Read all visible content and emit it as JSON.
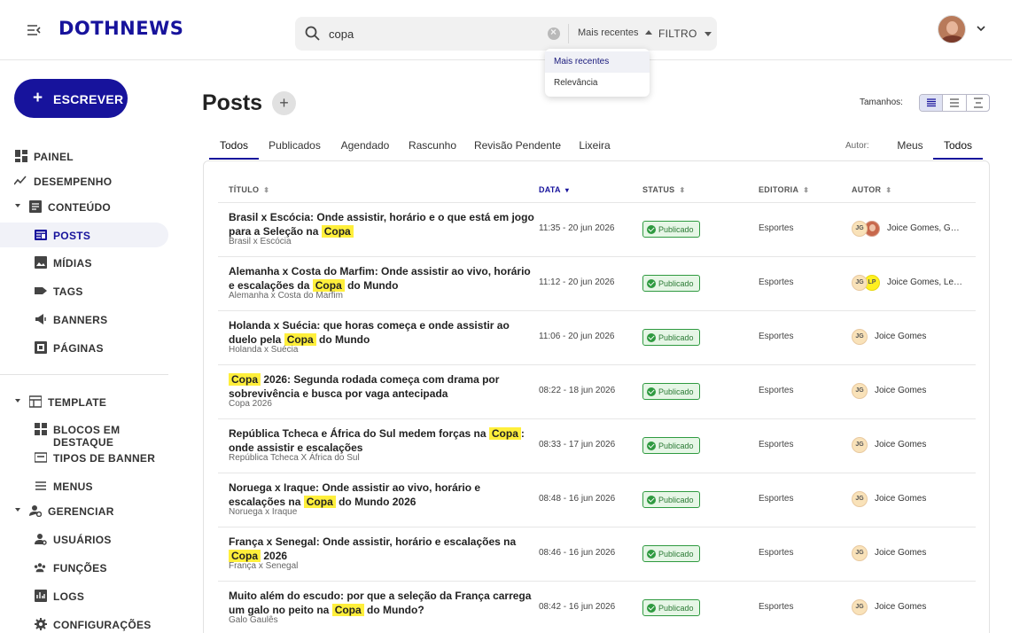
{
  "header": {
    "logo": "DOTHNEWS",
    "search": {
      "value": "copa"
    },
    "sort_label": "Mais recentes",
    "filter_label": "FILTRO",
    "sort_options": [
      "Mais recentes",
      "Relevância"
    ]
  },
  "sidebar": {
    "write_label": "ESCREVER",
    "items": [
      {
        "label": "PAINEL",
        "icon": "dashboard-icon"
      },
      {
        "label": "DESEMPENHO",
        "icon": "trending-icon"
      },
      {
        "label": "CONTEÚDO",
        "icon": "article-icon",
        "expanded": true
      },
      {
        "label": "POSTS",
        "icon": "posts-icon",
        "active": true
      },
      {
        "label": "MÍDIAS",
        "icon": "image-icon"
      },
      {
        "label": "TAGS",
        "icon": "tag-icon"
      },
      {
        "label": "BANNERS",
        "icon": "megaphone-icon"
      },
      {
        "label": "PÁGINAS",
        "icon": "pages-icon"
      },
      {
        "label": "TEMPLATE",
        "icon": "template-icon",
        "expanded": true
      },
      {
        "label": "BLOCOS EM DESTAQUE",
        "icon": "blocks-icon"
      },
      {
        "label": "TIPOS DE BANNER",
        "icon": "banner-type-icon"
      },
      {
        "label": "MENUS",
        "icon": "menu-lines-icon"
      },
      {
        "label": "GERENCIAR",
        "icon": "manage-icon",
        "expanded": true
      },
      {
        "label": "USUÁRIOS",
        "icon": "users-icon"
      },
      {
        "label": "FUNÇÕES",
        "icon": "roles-icon"
      },
      {
        "label": "LOGS",
        "icon": "logs-icon"
      },
      {
        "label": "CONFIGURAÇÕES",
        "icon": "settings-icon"
      }
    ]
  },
  "main": {
    "title": "Posts",
    "sizes_label": "Tamanhos:",
    "tabs": [
      "Todos",
      "Publicados",
      "Agendado",
      "Rascunho",
      "Revisão Pendente",
      "Lixeira"
    ],
    "author_label": "Autor:",
    "author_tabs": [
      "Meus",
      "Todos"
    ],
    "columns": [
      "TÍTULO",
      "DATA",
      "STATUS",
      "EDITORIA",
      "AUTOR"
    ],
    "rows": [
      {
        "title_before": "Brasil x Escócia: Onde assistir, horário e o que está em jogo para a Seleção na",
        "highlight": "Copa",
        "title_after": "",
        "subtitle": "Brasil x Escócia",
        "date": "11:35 - 20 jun 2026",
        "status": "Publicado",
        "editoria": "Esportes",
        "authors": [
          "JG",
          "photo"
        ],
        "author_name": "Joice Gomes, G…"
      },
      {
        "title_before": "Alemanha x Costa do Marfim: Onde assistir ao vivo, horário e escalações da",
        "highlight": "Copa",
        "title_after": "do Mundo",
        "subtitle": "Alemanha x Costa do Marfim",
        "date": "11:12 - 20 jun 2026",
        "status": "Publicado",
        "editoria": "Esportes",
        "authors": [
          "JG",
          "LP"
        ],
        "author_name": "Joice Gomes, Le…"
      },
      {
        "title_before": "Holanda x Suécia: que horas começa e onde assistir ao duelo pela",
        "highlight": "Copa",
        "title_after": "do Mundo",
        "subtitle": "Holanda x Suécia",
        "date": "11:06 - 20 jun 2026",
        "status": "Publicado",
        "editoria": "Esportes",
        "authors": [
          "JG"
        ],
        "author_name": "Joice Gomes"
      },
      {
        "title_before": "",
        "highlight": "Copa",
        "title_after": "2026: Segunda rodada começa com drama por sobrevivência e busca por vaga antecipada",
        "subtitle": "Copa 2026",
        "date": "08:22 - 18 jun 2026",
        "status": "Publicado",
        "editoria": "Esportes",
        "authors": [
          "JG"
        ],
        "author_name": "Joice Gomes"
      },
      {
        "title_before": "República Tcheca e África do Sul medem forças na",
        "highlight": "Copa",
        "title_after": ": onde assistir e escalações",
        "subtitle": "República Tcheca X África do Sul",
        "date": "08:33 - 17 jun 2026",
        "status": "Publicado",
        "editoria": "Esportes",
        "authors": [
          "JG"
        ],
        "author_name": "Joice Gomes"
      },
      {
        "title_before": "Noruega x Iraque: Onde assistir ao vivo, horário e escalações na",
        "highlight": "Copa",
        "title_after": "do Mundo 2026",
        "subtitle": "Noruega x Iraque",
        "date": "08:48 - 16 jun 2026",
        "status": "Publicado",
        "editoria": "Esportes",
        "authors": [
          "JG"
        ],
        "author_name": "Joice Gomes"
      },
      {
        "title_before": "França x Senegal: Onde assistir, horário e escalações na",
        "highlight": "Copa",
        "title_after": "2026",
        "subtitle": "França x Senegal",
        "date": "08:46 - 16 jun 2026",
        "status": "Publicado",
        "editoria": "Esportes",
        "authors": [
          "JG"
        ],
        "author_name": "Joice Gomes"
      },
      {
        "title_before": "Muito além do escudo: por que a seleção da França carrega um galo no peito na",
        "highlight": "Copa",
        "title_after": "do Mundo?",
        "subtitle": "Galo Gaulês",
        "date": "08:42 - 16 jun 2026",
        "status": "Publicado",
        "editoria": "Esportes",
        "authors": [
          "JG"
        ],
        "author_name": "Joice Gomes"
      }
    ]
  },
  "colors": {
    "brand": "#17139c",
    "highlight": "#ffef3b",
    "status_green": "#2f9a40"
  }
}
